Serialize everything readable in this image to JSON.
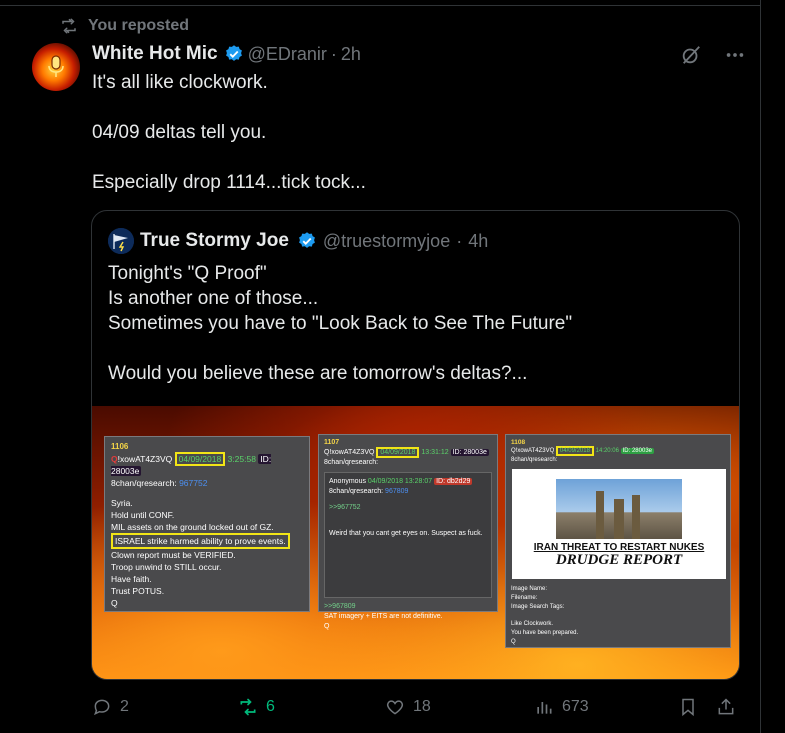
{
  "repost_banner": {
    "label": "You reposted"
  },
  "tweet": {
    "author_name": "White Hot Mic",
    "handle": "@EDranir",
    "separator": "·",
    "time": "2h",
    "lines": [
      "It's all like clockwork.",
      "04/09 deltas tell you.",
      "Especially drop 1114...tick tock..."
    ]
  },
  "quote": {
    "author_name": "True Stormy Joe",
    "handle": "@truestormyjoe",
    "separator": "·",
    "time": "4h",
    "lines": [
      "Tonight's \"Q Proof\"",
      "Is another one of those...",
      "Sometimes you have to \"Look Back to See The Future\"",
      "Would you believe these are tomorrow's deltas?..."
    ]
  },
  "media": {
    "panel1": {
      "number": "1106",
      "trip_q": "Q",
      "trip": "!xowAT4Z3VQ",
      "date": "04/09/2018",
      "time": "3:25:58",
      "id": "ID: 28003e",
      "board": "8chan/qresearch:",
      "post_no": "967752",
      "lines": [
        "Syria.",
        "Hold until CONF.",
        "MIL assets on the ground locked out of GZ.",
        "ISRAEL strike harmed ability to prove events.",
        "Clown report must be VERIFIED.",
        "Troop unwind to STILL occur.",
        "Have faith.",
        "Trust POTUS.",
        "Q"
      ]
    },
    "panel2": {
      "number": "1107",
      "trip": "Q!xowAT4Z3VQ",
      "date": "04/09/2018",
      "time": "13:31:12",
      "id": "ID: 28003e",
      "board": "8chan/qresearch:",
      "anon_name": "Anonymous",
      "anon_date": "04/09/2018 13:28:07",
      "anon_id": "ID: db2d29",
      "anon_board": "8chan/qresearch:",
      "anon_post": "967809",
      "reply_link": ">>967752",
      "reply_text": "Weird that you cant get eyes on. Suspect as fuck.",
      "reply_link2": ">>967809",
      "answer": "SAT imagery + EITS are not definitive.",
      "sign": "Q"
    },
    "panel3": {
      "number": "1108",
      "trip": "Q!xowAT4Z3VQ",
      "date": "04/09/2018",
      "time": "14:20:06",
      "id": "ID: 28003e",
      "board": "8chan/qresearch:",
      "headline_small": "IRAN THREAT TO RESTART NUKES",
      "headline_big": "DRUDGE REPORT",
      "meta1": "Image Name:",
      "meta2": "Filename:",
      "meta3": "Image Search Tags:",
      "lines": [
        "Like Clockwork.",
        "You have been prepared.",
        "Q"
      ]
    }
  },
  "actions": {
    "replies": "2",
    "reposts": "6",
    "likes": "18",
    "views": "673"
  },
  "colors": {
    "background": "#000000",
    "text": "#e7e9ea",
    "muted": "#71767b",
    "repost_green": "#00ba7c",
    "verified_blue": "#1d9bf0"
  }
}
